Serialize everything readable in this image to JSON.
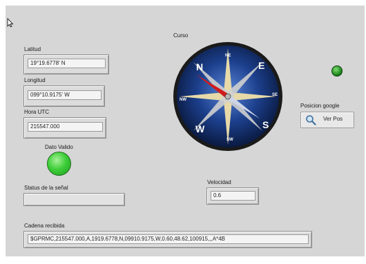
{
  "labels": {
    "latitud": "Latitud",
    "longitud": "Longitud",
    "hora_utc": "Hora UTC",
    "dato_valido": "Dato Valido",
    "status": "Status de la señal",
    "curso": "Curso",
    "velocidad": "Velocidad",
    "cadena": "Cadena recibida",
    "posicion_google": "Posicion google"
  },
  "values": {
    "latitud": "19°19.6778' N",
    "longitud": "099°10.9175' W",
    "hora_utc": "215547.000",
    "status": "",
    "velocidad": "0.6",
    "cadena": "$GPRMC,215547.000,A,1919.6778,N,09910.9175,W,0.60,48.62,100915,,,A*4B"
  },
  "compass": {
    "letters": {
      "n": "N",
      "e": "E",
      "s": "S",
      "w": "W",
      "ne": "NE",
      "se": "SE",
      "sw": "SW",
      "nw": "NW"
    }
  },
  "ver_pos_button": {
    "label": "Ver Pos",
    "icon": "magnifier-icon"
  },
  "colors": {
    "panel_bg": "#d6d6d6",
    "led_valid": "#2db82d",
    "led_small": "#1f8a1f",
    "compass_blue": "#1c3f8c",
    "needle_red": "#d01c1c"
  }
}
